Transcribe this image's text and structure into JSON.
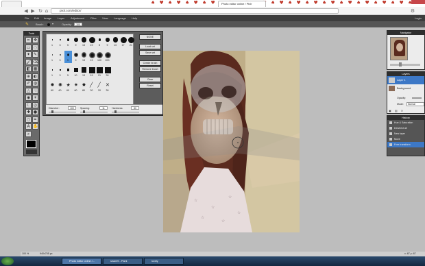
{
  "browser": {
    "suits": "♠ ♥ ♠ ♥ ♠ ♥ ♠ ♥ ♠ ♥ ♠ ♥ ♠ ♥ ♠ ♥ ♠ ♥ ♠ ♥ ♠ ♥ ♠ ♥ ♠ ♥ ♠ ♥ ♠ ♥ ♠ ♥ ♠ ♥ ♠ ♥",
    "tab_label": "Photo editor online / Pixlr",
    "url": "pixlr.com/editor/"
  },
  "menu": [
    "File",
    "Edit",
    "Image",
    "Layer",
    "Adjustment",
    "Filter",
    "View",
    "Language",
    "Help"
  ],
  "menu_right": "Login",
  "options": {
    "brush_label": "Brush:",
    "opacity_label": "Opacity:",
    "opacity_value": "100"
  },
  "tools_panel": {
    "title": "Tools",
    "icons": [
      "crop-icon",
      "move-icon",
      "marquee-icon",
      "lasso-icon",
      "wand-icon",
      "pencil-icon",
      "brush-icon",
      "eraser-icon",
      "bucket-icon",
      "gradient-icon",
      "clone-icon",
      "color-replace-icon",
      "drawing-icon",
      "blur-icon",
      "sharpen-icon",
      "smudge-icon",
      "sponge-icon",
      "dodge-icon",
      "burn-icon",
      "redeye-icon",
      "spot-heal-icon",
      "bloat-icon",
      "pinch-icon",
      "picker-icon",
      "text-icon",
      "hand-icon",
      "zoom-icon"
    ],
    "fg_color": "#000000"
  },
  "brush_panel": {
    "rows": [
      {
        "kind": "hard",
        "sizes": [
          "1",
          "3",
          "5",
          "9",
          "13",
          "19",
          "5",
          "9",
          "13",
          "17",
          "21"
        ]
      },
      {
        "kind": "soft",
        "sizes": [
          "1",
          "3",
          "5",
          "9",
          "13",
          "19",
          "100",
          "200"
        ]
      },
      {
        "kind": "square",
        "sizes": [
          "1",
          "3",
          "5",
          "10",
          "13",
          "19",
          "21",
          "30"
        ]
      },
      {
        "kind": "shape",
        "sizes": [
          "60",
          "60",
          "60",
          "60",
          "80",
          "20",
          "20",
          "30"
        ]
      }
    ],
    "selected_index": 13,
    "buttons": [
      "NONE",
      "Load set",
      "Save set",
      "Create brush",
      "Remove brush",
      "Clear",
      "Reset"
    ],
    "sliders": [
      {
        "label": "Diameter:",
        "value": "100"
      },
      {
        "label": "Spacing:",
        "value": "11"
      },
      {
        "label": "Hardness:",
        "value": "80"
      }
    ]
  },
  "navigator": {
    "title": "Navigator",
    "zoom": "40"
  },
  "layers": {
    "title": "Layers",
    "items": [
      {
        "name": "Layer 1",
        "selected": true
      },
      {
        "name": "Background",
        "selected": false
      }
    ],
    "opacity_label": "Opacity:",
    "mode_label": "Mode:",
    "mode_value": "Normal"
  },
  "history": {
    "title": "History",
    "items": [
      "Hue & Saturation",
      "Deselect all",
      "New layer",
      "Move",
      "Free transform"
    ],
    "selected_index": 4
  },
  "status": {
    "zoom": "100 %",
    "size": "940x705 px",
    "coords": "x: 87  y: 87"
  },
  "taskbar": [
    "Photo editor online /...",
    "shan09 - Paint",
    "lovely"
  ]
}
